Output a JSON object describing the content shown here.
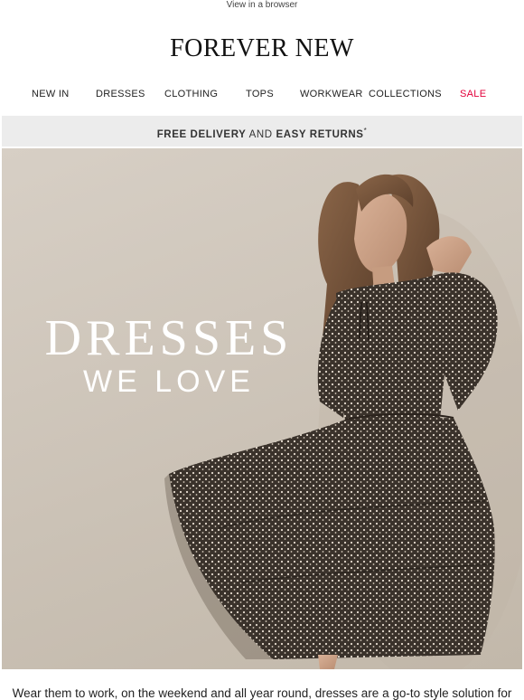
{
  "preheader": {
    "view_in_browser": "View in a browser"
  },
  "header": {
    "brand": "FOREVER NEW"
  },
  "nav": {
    "items": [
      {
        "label": "NEW IN"
      },
      {
        "label": "DRESSES"
      },
      {
        "label": "CLOTHING"
      },
      {
        "label": "TOPS"
      },
      {
        "label": "WORKWEAR"
      },
      {
        "label": "COLLECTIONS"
      },
      {
        "label": "SALE"
      }
    ],
    "sale_color": "#e2003b"
  },
  "promo_banner": {
    "part1": "FREE DELIVERY",
    "part2": " AND ",
    "part3": "EASY RETURNS",
    "asterisk": "*"
  },
  "hero": {
    "title": "DRESSES",
    "subtitle": "WE LOVE"
  },
  "body": {
    "text": "Wear them to work, on the weekend and all year round, dresses are a go-to style solution for"
  }
}
